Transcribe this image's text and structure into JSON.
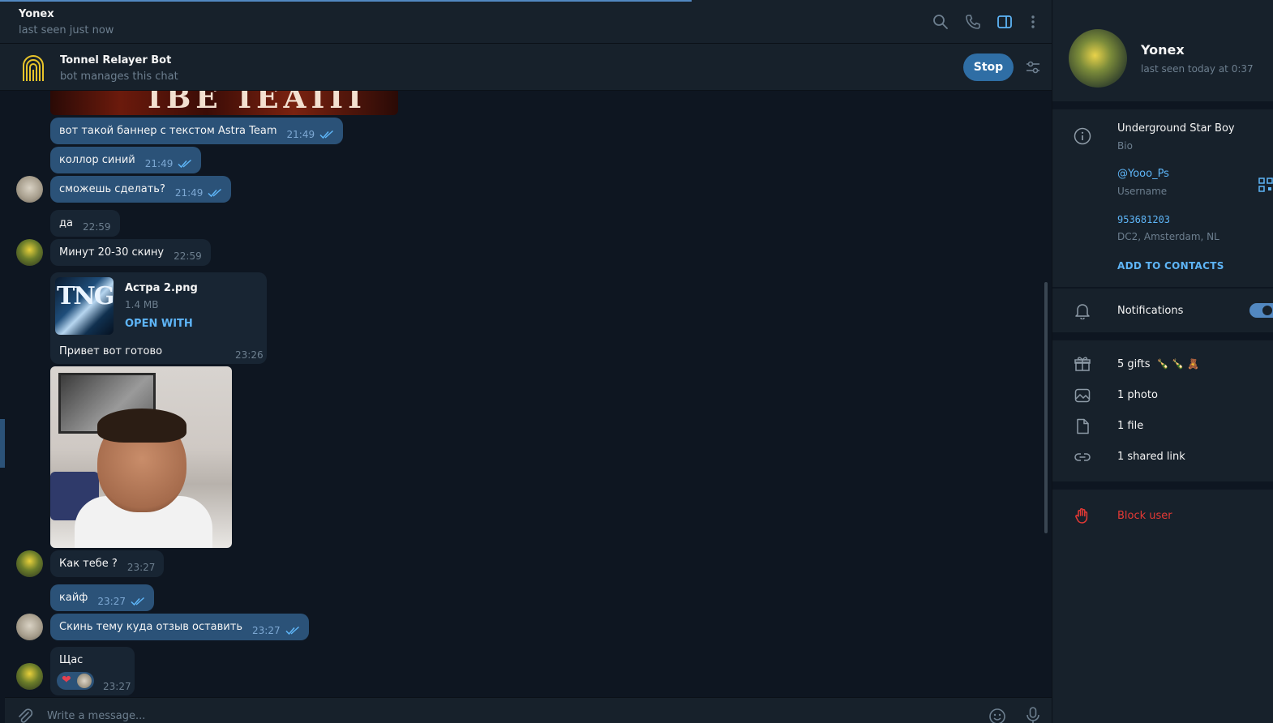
{
  "header": {
    "name": "Yonex",
    "status": "last seen just now"
  },
  "bot_bar": {
    "name": "Tonnel Relayer Bot",
    "subtitle": "bot manages this chat",
    "stop_label": "Stop"
  },
  "banner": {
    "text": "IBE IEAIII"
  },
  "messages": [
    {
      "text": "вот такой баннер с текстом Astra Team",
      "time": "21:49"
    },
    {
      "text": "коллор синий",
      "time": "21:49"
    },
    {
      "text": "сможешь сделать?",
      "time": "21:49"
    },
    {
      "text": "да",
      "time": "22:59"
    },
    {
      "text": "Минут 20-30 скину",
      "time": "22:59"
    },
    {
      "text": "Как тебе ?",
      "time": "23:27"
    },
    {
      "text": "кайф",
      "time": "23:27"
    },
    {
      "text": "Скинь тему куда отзыв оставить",
      "time": "23:27"
    }
  ],
  "file_message": {
    "thumb_text": "TNG",
    "file_name": "Астра 2.png",
    "file_size": "1.4 MB",
    "open_label": "OPEN WITH",
    "caption": "Привет вот готово",
    "time": "23:26"
  },
  "reaction_message": {
    "text": "Щас",
    "reaction": "❤",
    "time": "23:27"
  },
  "composer": {
    "placeholder": "Write a message..."
  },
  "profile": {
    "name": "Yonex",
    "status": "last seen today at 0:37",
    "bio": "Underground Star Boy",
    "bio_label": "Bio",
    "username": "@Yooo_Ps",
    "username_label": "Username",
    "user_id": "953681203",
    "dc": "DC2, Amsterdam, NL",
    "add_contacts": "ADD TO CONTACTS",
    "notifications": "Notifications",
    "gifts": "5 gifts",
    "gift_emojis": "🍾 🍾 🧸",
    "photos": "1 photo",
    "files": "1 file",
    "links": "1 shared link",
    "block": "Block user"
  },
  "colors": {
    "accent": "#5288c1",
    "outgoing_bubble": "#2b5278",
    "incoming_bubble": "#182533",
    "link": "#5eb5f7",
    "danger": "#e53935"
  }
}
